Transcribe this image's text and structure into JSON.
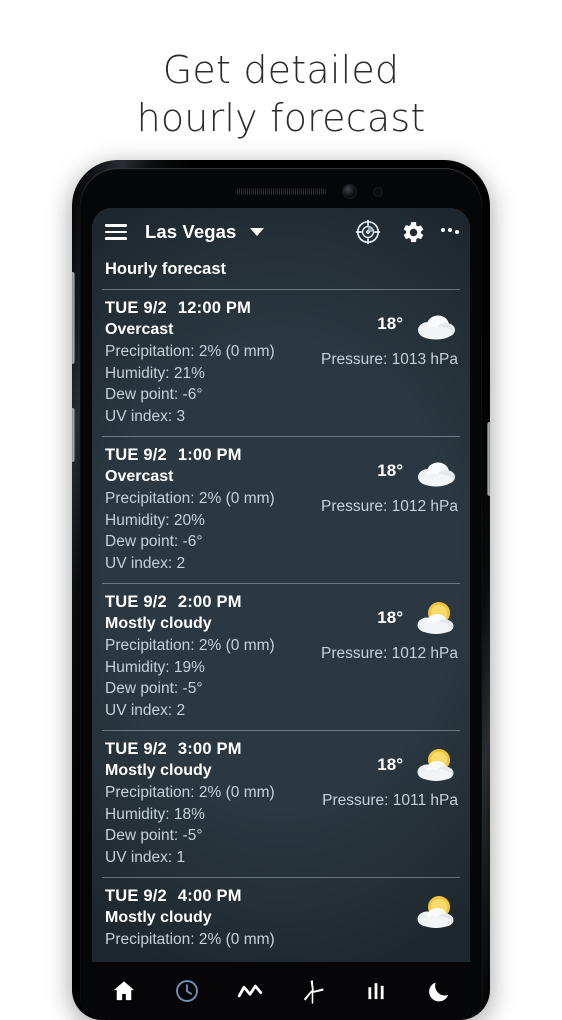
{
  "promo": {
    "headline": "Get detailed\nhourly forecast"
  },
  "appbar": {
    "menu_icon": "hamburger-menu-icon",
    "city": "Las Vegas",
    "dropdown_icon": "chevron-down-icon",
    "locate_icon": "locate-gps-icon",
    "settings_icon": "gear-icon",
    "overflow_icon": "kebab-menu-icon"
  },
  "section": {
    "title": "Hourly forecast"
  },
  "forecast": [
    {
      "date": "TUE 9/2",
      "time": "12:00 PM",
      "condition": "Overcast",
      "precipitation": "Precipitation: 2% (0 mm)",
      "humidity": "Humidity: 21%",
      "dew_point": "Dew point: -6°",
      "uv_index": "UV index: 3",
      "temperature": "18°",
      "pressure": "Pressure: 1013 hPa",
      "icon": "cloud-overcast-icon"
    },
    {
      "date": "TUE 9/2",
      "time": "1:00 PM",
      "condition": "Overcast",
      "precipitation": "Precipitation: 2% (0 mm)",
      "humidity": "Humidity: 20%",
      "dew_point": "Dew point: -6°",
      "uv_index": "UV index: 2",
      "temperature": "18°",
      "pressure": "Pressure: 1012 hPa",
      "icon": "cloud-overcast-icon"
    },
    {
      "date": "TUE 9/2",
      "time": "2:00 PM",
      "condition": "Mostly cloudy",
      "precipitation": "Precipitation: 2% (0 mm)",
      "humidity": "Humidity: 19%",
      "dew_point": "Dew point: -5°",
      "uv_index": "UV index: 2",
      "temperature": "18°",
      "pressure": "Pressure: 1012 hPa",
      "icon": "sun-behind-cloud-icon"
    },
    {
      "date": "TUE 9/2",
      "time": "3:00 PM",
      "condition": "Mostly cloudy",
      "precipitation": "Precipitation: 2% (0 mm)",
      "humidity": "Humidity: 18%",
      "dew_point": "Dew point: -5°",
      "uv_index": "UV index: 1",
      "temperature": "18°",
      "pressure": "Pressure: 1011 hPa",
      "icon": "sun-behind-cloud-icon"
    },
    {
      "date": "TUE 9/2",
      "time": "4:00 PM",
      "condition": "Mostly cloudy",
      "precipitation": "Precipitation: 2% (0 mm)",
      "humidity": "",
      "dew_point": "",
      "uv_index": "",
      "temperature": "",
      "pressure": "",
      "icon": "sun-behind-cloud-icon"
    }
  ],
  "bottom_nav": [
    {
      "name": "home-icon",
      "selected": false
    },
    {
      "name": "clock-icon",
      "selected": true
    },
    {
      "name": "line-chart-icon",
      "selected": false
    },
    {
      "name": "wind-turbine-icon",
      "selected": false
    },
    {
      "name": "bar-chart-icon",
      "selected": false
    },
    {
      "name": "moon-icon",
      "selected": false
    }
  ],
  "colors": {
    "accent_selected": "#6f93b8",
    "screen_bg": "#2b3841",
    "nav_bg": "#060608",
    "text_primary": "#ffffff",
    "text_secondary": "#c6d1da",
    "sun_yellow": "#f2c53d",
    "cloud_white": "#f4f6f7"
  }
}
